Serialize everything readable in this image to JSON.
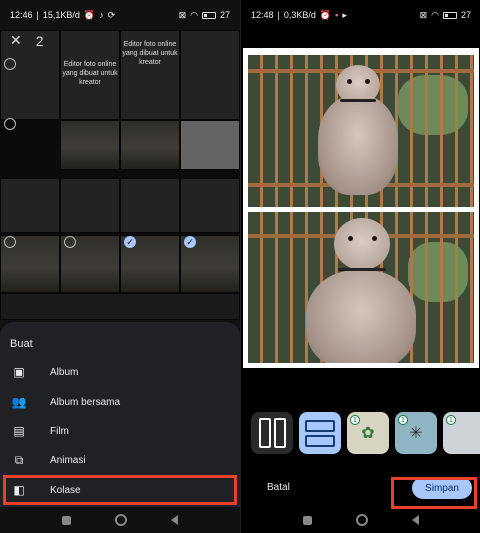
{
  "left": {
    "status": {
      "time": "12:46",
      "network": "15,1KB/d",
      "battery": "27"
    },
    "selection": {
      "count": "2"
    },
    "overlay_text": "Editor foto online yang dibuat untuk kreator",
    "sheet": {
      "title": "Buat",
      "items": [
        {
          "label": "Album",
          "icon": "photo-album-icon"
        },
        {
          "label": "Album bersama",
          "icon": "people-icon"
        },
        {
          "label": "Film",
          "icon": "movie-icon"
        },
        {
          "label": "Animasi",
          "icon": "animation-icon"
        },
        {
          "label": "Kolase",
          "icon": "collage-icon"
        }
      ]
    }
  },
  "right": {
    "status": {
      "time": "12:48",
      "network": "0,3KB/d",
      "battery": "27"
    },
    "actions": {
      "cancel": "Batal",
      "save": "Simpan"
    },
    "layouts": [
      {
        "type": "two-vertical",
        "selected": false
      },
      {
        "type": "two-horizontal",
        "selected": true
      },
      {
        "type": "template",
        "selected": false
      },
      {
        "type": "template",
        "selected": false
      },
      {
        "type": "template",
        "selected": false
      }
    ]
  },
  "colors": {
    "accent": "#a8c7fa",
    "highlight": "#e8402a",
    "sheet": "#202124"
  }
}
